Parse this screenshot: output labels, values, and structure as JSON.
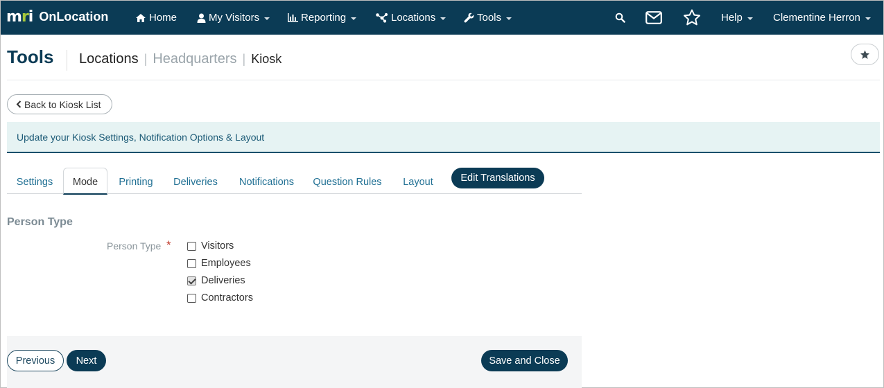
{
  "brand": {
    "mark_left": "m",
    "mark_green": "r",
    "mark_right": "i",
    "name": "OnLocation"
  },
  "nav": {
    "home": "Home",
    "my_visitors": "My Visitors",
    "reporting": "Reporting",
    "locations": "Locations",
    "tools": "Tools",
    "help": "Help",
    "user": "Clementine Herron"
  },
  "header": {
    "title": "Tools",
    "breadcrumb": [
      "Locations",
      "Headquarters",
      "Kiosk"
    ]
  },
  "back_button": "Back to Kiosk List",
  "banner": "Update your Kiosk Settings, Notification Options & Layout",
  "tabs": {
    "items": [
      "Settings",
      "Mode",
      "Printing",
      "Deliveries",
      "Notifications",
      "Question Rules",
      "Layout"
    ],
    "active": "Mode",
    "edit_translations": "Edit Translations"
  },
  "section": {
    "title": "Person Type",
    "field_label": "Person Type",
    "required_mark": "*",
    "options": [
      {
        "label": "Visitors",
        "checked": false
      },
      {
        "label": "Employees",
        "checked": false
      },
      {
        "label": "Deliveries",
        "checked": true
      },
      {
        "label": "Contractors",
        "checked": false
      }
    ]
  },
  "footer": {
    "previous": "Previous",
    "next": "Next",
    "save_close": "Save and Close"
  },
  "colors": {
    "navbar": "#0b3b55",
    "accent_green": "#a6c83a",
    "tab_link": "#1f6f93",
    "banner_bg": "#e6f3f3",
    "required": "#c0392b"
  }
}
